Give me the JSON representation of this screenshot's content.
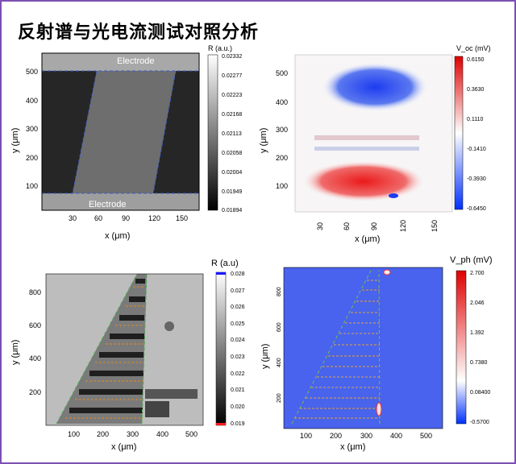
{
  "title": "反射谱与光电流测试对照分析",
  "p1": {
    "xlabel": "x (μm)",
    "ylabel": "y (μm)",
    "cbar_title": "R (a.u.)",
    "xticks": [
      "30",
      "60",
      "90",
      "120",
      "150"
    ],
    "yticks": [
      "500",
      "400",
      "300",
      "200",
      "100"
    ],
    "cbar_ticks": [
      "0.02332",
      "0.02277",
      "0.02223",
      "0.02168",
      "0.02113",
      "0.02058",
      "0.02004",
      "0.01949",
      "0.01894"
    ],
    "electrode_top": "Electrode",
    "electrode_bottom": "Electrode"
  },
  "p2": {
    "xlabel": "x (μm)",
    "ylabel": "y (μm)",
    "cbar_title": "V_oc (mV)",
    "xticks": [
      "30",
      "60",
      "90",
      "120",
      "150"
    ],
    "yticks": [
      "500",
      "400",
      "300",
      "200",
      "100"
    ],
    "cbar_ticks": [
      "0.6150",
      "0.3630",
      "0.1110",
      "-0.1410",
      "-0.3930",
      "-0.6450"
    ]
  },
  "p3": {
    "xlabel": "x (μm)",
    "ylabel": "y (μm)",
    "cbar_title": "R (a.u)",
    "xticks": [
      "100",
      "200",
      "300",
      "400",
      "500"
    ],
    "yticks": [
      "800",
      "600",
      "400",
      "200"
    ],
    "cbar_ticks": [
      "0.028",
      "0.027",
      "0.026",
      "0.025",
      "0.024",
      "0.023",
      "0.022",
      "0.021",
      "0.020",
      "0.019"
    ]
  },
  "p4": {
    "xlabel": "x (μm)",
    "ylabel": "y (μm)",
    "cbar_title": "V_ph (mV)",
    "xticks": [
      "100",
      "200",
      "300",
      "400",
      "500"
    ],
    "yticks": [
      "800",
      "600",
      "400",
      "200"
    ],
    "cbar_ticks": [
      "2.700",
      "2.046",
      "1.392",
      "0.7380",
      "0.08400",
      "-0.5700"
    ]
  }
}
